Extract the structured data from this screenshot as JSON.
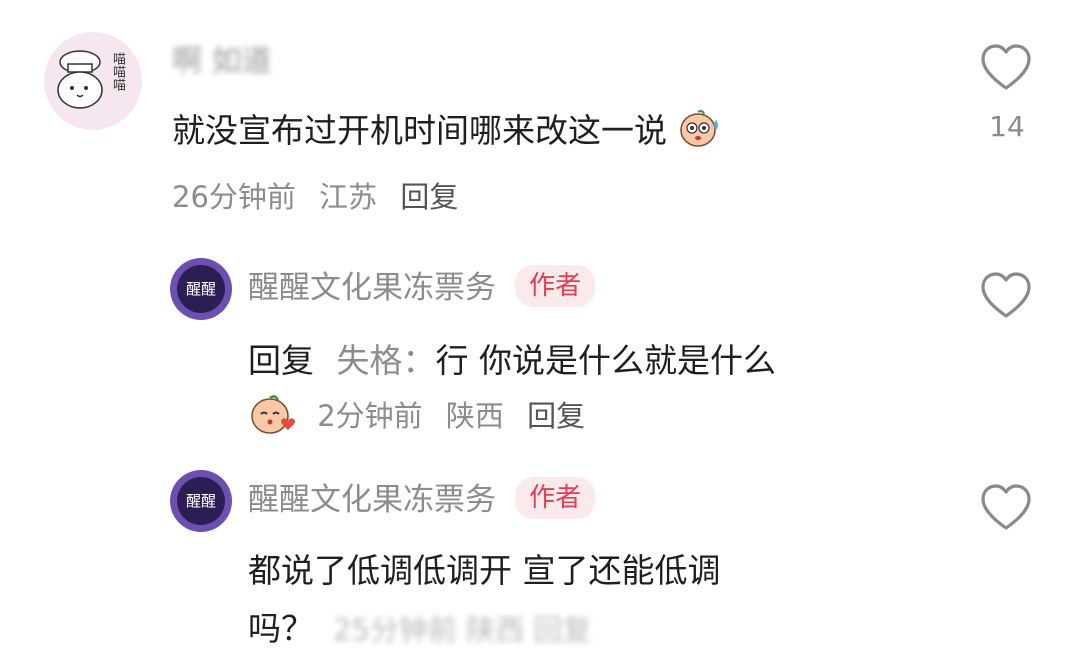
{
  "comments": [
    {
      "username": "啊 如道",
      "avatar_text": [
        "喵",
        "喵",
        "喵"
      ],
      "text": "就没宣布过开机时间哪来改这一说",
      "emoji": "sweat-emoji",
      "time": "26分钟前",
      "location": "江苏",
      "reply_label": "回复",
      "like_count": "14"
    }
  ],
  "replies": [
    {
      "username": "醒醒文化果冻票务",
      "badge": "作者",
      "avatar_text": "醒醒",
      "reply_prefix": "回复",
      "reply_to": "失格：",
      "text": "行 你说是什么就是什么",
      "emoji": "kiss-emoji",
      "time": "2分钟前",
      "location": "陕西",
      "reply_label": "回复"
    },
    {
      "username": "醒醒文化果冻票务",
      "badge": "作者",
      "avatar_text": "醒醒",
      "text_line1": "都说了低调低调开 宣了还能低调",
      "text_line2": "吗？",
      "time": "25分钟前 陕西 回复"
    }
  ],
  "colors": {
    "badge_bg": "#fbeaec",
    "badge_text": "#e33d55",
    "meta_text": "#8c8c8c",
    "body_text": "#1f1f1f"
  }
}
